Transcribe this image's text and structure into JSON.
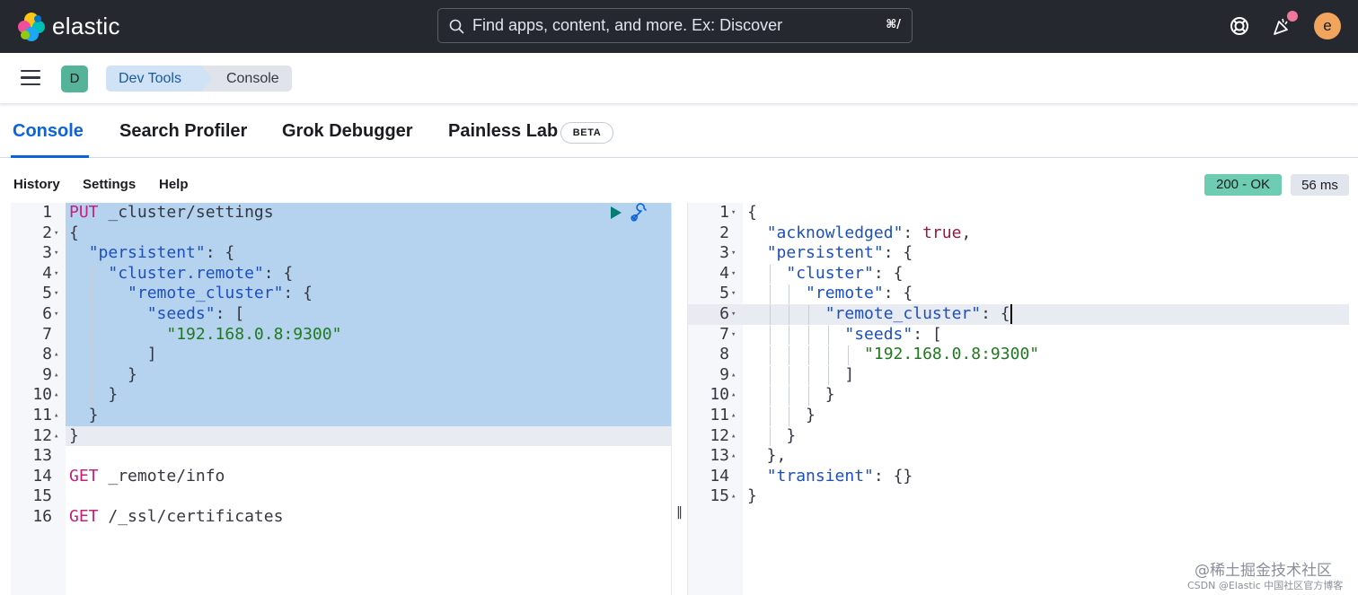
{
  "app": {
    "brand": "elastic"
  },
  "search": {
    "placeholder": "Find apps, content, and more. Ex: Discover",
    "shortcut": "⌘/"
  },
  "header": {
    "avatar_initial": "e",
    "space_initial": "D"
  },
  "breadcrumbs": [
    "Dev Tools",
    "Console"
  ],
  "tabs": [
    {
      "label": "Console",
      "active": true
    },
    {
      "label": "Search Profiler"
    },
    {
      "label": "Grok Debugger"
    },
    {
      "label": "Painless Lab",
      "badge": "BETA"
    }
  ],
  "toolbar": {
    "history": "History",
    "settings": "Settings",
    "help": "Help"
  },
  "response_status": {
    "status": "200 - OK",
    "time": "56 ms"
  },
  "request_editor": {
    "line_numbers": [
      "1",
      "2",
      "3",
      "4",
      "5",
      "6",
      "7",
      "8",
      "9",
      "10",
      "11",
      "12",
      "13",
      "14",
      "15",
      "16"
    ],
    "lines": [
      "PUT _cluster/settings",
      "{",
      "  \"persistent\": {",
      "    \"cluster.remote\": {",
      "      \"remote_cluster\": {",
      "        \"seeds\": [",
      "          \"192.168.0.8:9300\"",
      "        ]",
      "      }",
      "    }",
      "  }",
      "}",
      "",
      "GET _remote/info",
      "",
      "GET /_ssl/certificates"
    ]
  },
  "response_editor": {
    "line_numbers": [
      "1",
      "2",
      "3",
      "4",
      "5",
      "6",
      "7",
      "8",
      "9",
      "10",
      "11",
      "12",
      "13",
      "14",
      "15"
    ],
    "lines": [
      "{",
      "  \"acknowledged\": true,",
      "  \"persistent\": {",
      "    \"cluster\": {",
      "      \"remote\": {",
      "        \"remote_cluster\": {",
      "          \"seeds\": [",
      "            \"192.168.0.8:9300\"",
      "          ]",
      "        }",
      "      }",
      "    }",
      "  },",
      "  \"transient\": {}",
      "}"
    ]
  },
  "watermark": {
    "line1": "@稀土掘金技术社区",
    "line2": "CSDN @Elastic 中国社区官方博客"
  },
  "colors": {
    "topbar": "#25282f",
    "accent": "#0b64dd",
    "selection": "#b5d3ef",
    "status_ok": "#6dccb1",
    "method": "#c61e7b",
    "key": "#1c4fbf",
    "string": "#1f7a1f"
  },
  "icons": [
    "elastic-logo",
    "search-icon",
    "help-icon",
    "newsfeed-icon",
    "hamburger-menu-icon",
    "play-icon",
    "wrench-icon"
  ]
}
